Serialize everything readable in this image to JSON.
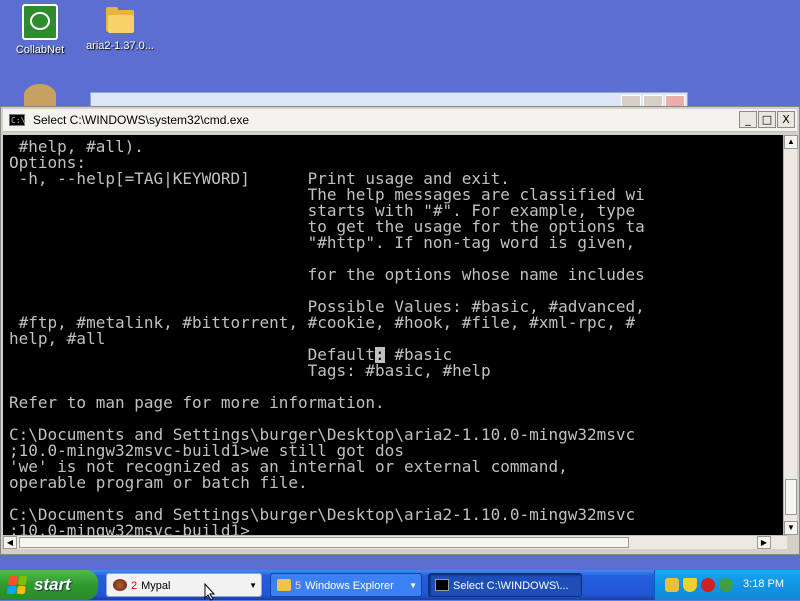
{
  "desktop": {
    "icons": [
      {
        "label": "CollabNet",
        "icon": "collabnet-icon"
      },
      {
        "label": "aria2-1.37.0...",
        "icon": "folder-icon"
      }
    ]
  },
  "cmd_window": {
    "title": "Select C:\\WINDOWS\\system32\\cmd.exe",
    "icon_text": "C:\\",
    "buttons": {
      "minimize": "_",
      "maximize": "□",
      "close": "X"
    },
    "console_lines": [
      " #help, #all).",
      "Options:",
      " -h, --help[=TAG|KEYWORD]      Print usage and exit.",
      "                               The help messages are classified wi",
      "                               starts with \"#\". For example, type ",
      "                               to get the usage for the options ta",
      "                               \"#http\". If non-tag word is given, ",
      "",
      "                               for the options whose name includes",
      "",
      "                               Possible Values: #basic, #advanced,",
      " #ftp, #metalink, #bittorrent, #cookie, #hook, #file, #xml-rpc, #",
      "help, #all",
      "                               Default",
      "                               Tags: #basic, #help",
      "",
      "Refer to man page for more information.",
      "",
      "C:\\Documents and Settings\\burger\\Desktop\\aria2-1.10.0-mingw32msvc",
      ";10.0-mingw32msvc-build1>we still got dos",
      "'we' is not recognized as an internal or external command,",
      "operable program or batch file.",
      "",
      "C:\\Documents and Settings\\burger\\Desktop\\aria2-1.10.0-mingw32msvc",
      ";10.0-mingw32msvc-build1>"
    ],
    "default_cursor_char": ":",
    "default_tail": " #basic"
  },
  "taskbar": {
    "start_label": "start",
    "tasks": [
      {
        "count": "2",
        "label": "Mypal"
      },
      {
        "count": "5",
        "label": "Windows Explorer"
      },
      {
        "count": "",
        "label": "Select C:\\WINDOWS\\..."
      }
    ],
    "clock": "3:18 PM"
  },
  "colors": {
    "console_bg": "#000000",
    "console_fg": "#c0c0c0",
    "taskbar_blue": "#245edb",
    "start_green": "#3aa53a"
  }
}
